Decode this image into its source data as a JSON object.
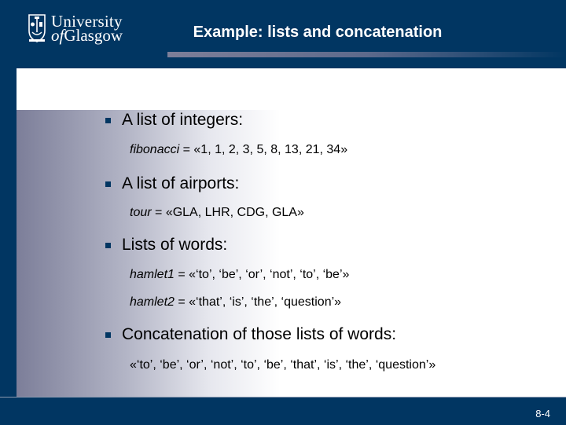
{
  "header": {
    "logo": {
      "line1": "University",
      "line2_prefix": "of",
      "line2_rest": "Glasgow",
      "icon": "university-crest-icon"
    },
    "title": "Example: lists and concatenation"
  },
  "bullets": [
    {
      "label": "A list of integers:",
      "lines": [
        {
          "var": "fibonacci",
          "eq": " = ",
          "value": "«1, 1, 2, 3, 5, 8, 13, 21, 34»"
        }
      ]
    },
    {
      "label": "A list of airports:",
      "lines": [
        {
          "var": "tour",
          "eq": " = ",
          "value": "«GLA, LHR, CDG, GLA»"
        }
      ]
    },
    {
      "label": "Lists of words:",
      "lines": [
        {
          "var": "hamlet1",
          "eq": " = ",
          "value": "«‘to’, ‘be’, ‘or’, ‘not’, ‘to’, ‘be’»"
        },
        {
          "var": "hamlet2",
          "eq": " = ",
          "value": "«‘that’, ‘is’, ‘the’, ‘question’»"
        }
      ]
    },
    {
      "label": "Concatenation of those lists of words:",
      "lines": [
        {
          "var": "",
          "eq": "",
          "value": "«‘to’, ‘be’, ‘or’, ‘not’, ‘to’, ‘be’, ‘that’, ‘is’, ‘the’, ‘question’»"
        }
      ]
    }
  ],
  "footer": {
    "page_number": "8-4"
  },
  "colors": {
    "brand_navy": "#013662",
    "text": "#000000",
    "bullet": "#013662"
  }
}
